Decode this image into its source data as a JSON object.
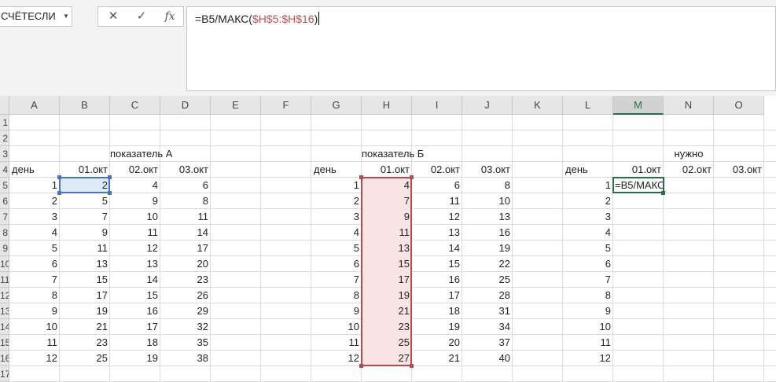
{
  "name_box": {
    "value": "СЧЁТЕСЛИ"
  },
  "formula_bar": {
    "prefix": "=B5/МАКС(",
    "ref": "$H$5:$H$16",
    "suffix": ")"
  },
  "fx_buttons": {
    "cancel": "✕",
    "enter": "✓",
    "fx": "fx"
  },
  "columns": [
    "A",
    "B",
    "C",
    "D",
    "E",
    "F",
    "G",
    "H",
    "I",
    "J",
    "K",
    "L",
    "M",
    "N",
    "O"
  ],
  "row_numbers": [
    "1",
    "2",
    "3",
    "4",
    "5",
    "6",
    "7",
    "8",
    "9",
    "10",
    "11",
    "12",
    "13",
    "14",
    "15",
    "16",
    "17"
  ],
  "headers": {
    "a_title": "показатель А",
    "b_title": "показатель Б",
    "c_title": "нужно",
    "day": "день",
    "d1": "01.окт",
    "d2": "02.окт",
    "d3": "03.окт"
  },
  "table_a": {
    "days": [
      "1",
      "2",
      "3",
      "4",
      "5",
      "6",
      "7",
      "8",
      "9",
      "10",
      "11",
      "12"
    ],
    "col1": [
      "2",
      "5",
      "7",
      "9",
      "11",
      "13",
      "15",
      "17",
      "19",
      "21",
      "23",
      "25"
    ],
    "col2": [
      "4",
      "9",
      "10",
      "11",
      "12",
      "13",
      "14",
      "15",
      "16",
      "17",
      "18",
      "19"
    ],
    "col3": [
      "6",
      "8",
      "11",
      "14",
      "17",
      "20",
      "23",
      "26",
      "29",
      "32",
      "35",
      "38"
    ]
  },
  "table_b": {
    "days": [
      "1",
      "2",
      "3",
      "4",
      "5",
      "6",
      "7",
      "8",
      "9",
      "10",
      "11",
      "12"
    ],
    "col1": [
      "4",
      "7",
      "9",
      "11",
      "13",
      "15",
      "17",
      "19",
      "21",
      "23",
      "25",
      "27"
    ],
    "col2": [
      "6",
      "11",
      "12",
      "13",
      "14",
      "15",
      "16",
      "17",
      "18",
      "19",
      "20",
      "21"
    ],
    "col3": [
      "8",
      "10",
      "13",
      "16",
      "19",
      "22",
      "25",
      "28",
      "31",
      "34",
      "37",
      "40"
    ]
  },
  "table_c": {
    "days": [
      "1",
      "2",
      "3",
      "4",
      "5",
      "6",
      "7",
      "8",
      "9",
      "10",
      "11",
      "12"
    ],
    "editing_text": "=B5/МАКС"
  },
  "colors": {
    "selection_green": "#217346",
    "reference_red": "#c0504d",
    "cell_blue": "#4472c4"
  }
}
